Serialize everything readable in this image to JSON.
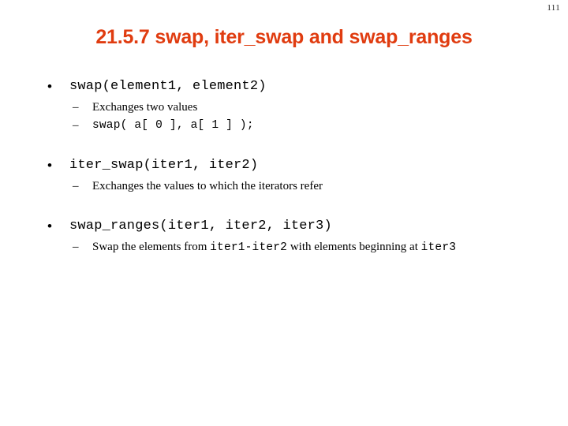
{
  "slide": {
    "page_number": "111",
    "title": "21.5.7 swap, iter_swap and swap_ranges",
    "title_color": "#E03C10",
    "background_color": "#FFFFFF",
    "text_color": "#000000",
    "bullet_marker_l1": "•",
    "bullet_marker_l2": "–"
  },
  "sections": [
    {
      "heading": "swap(element1, element2)",
      "subs": [
        {
          "style": "prose",
          "text": "Exchanges two values"
        },
        {
          "style": "code",
          "text": "swap( a[ 0 ], a[ 1 ] );"
        }
      ]
    },
    {
      "heading": "iter_swap(iter1, iter2)",
      "subs": [
        {
          "style": "prose",
          "text": "Exchanges the values to which the iterators refer"
        }
      ]
    },
    {
      "heading": "swap_ranges(iter1, iter2, iter3)",
      "subs": [
        {
          "style": "mixed",
          "parts": [
            {
              "font": "serif",
              "text": "Swap the elements from "
            },
            {
              "font": "mono",
              "text": "iter1-iter2"
            },
            {
              "font": "serif",
              "text": " with elements beginning at "
            },
            {
              "font": "mono",
              "text": "iter3"
            }
          ],
          "text": "Swap the elements from iter1-iter2 with elements beginning at iter3"
        }
      ]
    }
  ]
}
